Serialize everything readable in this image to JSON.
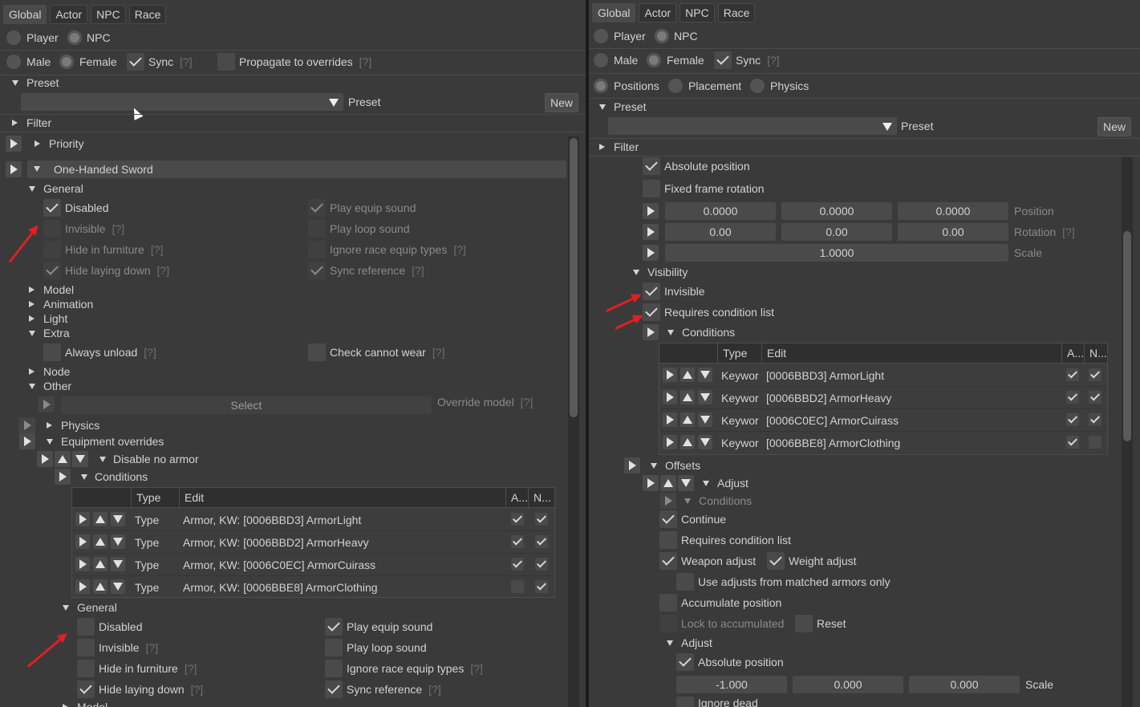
{
  "tabs": [
    "Global",
    "Actor",
    "NPC",
    "Race"
  ],
  "hint": "[?]",
  "left": {
    "player": "Player",
    "npc": "NPC",
    "male": "Male",
    "female": "Female",
    "sync": "Sync",
    "propagate": "Propagate to overrides",
    "preset_section": "Preset",
    "preset_label": "Preset",
    "new_button": "New",
    "filter": "Filter",
    "priority": "Priority",
    "sword": "One-Handed Sword",
    "general": "General",
    "disabled": "Disabled",
    "invisible": "Invisible",
    "hide_furniture": "Hide in furniture",
    "hide_laying": "Hide laying down",
    "play_equip": "Play equip sound",
    "play_loop": "Play loop sound",
    "ignore_race": "Ignore race equip types",
    "sync_ref": "Sync reference",
    "model": "Model",
    "animation": "Animation",
    "light": "Light",
    "extra": "Extra",
    "always_unload": "Always unload",
    "check_cannot_wear": "Check cannot wear",
    "node": "Node",
    "other": "Other",
    "select": "Select",
    "override_model": "Override model",
    "physics": "Physics",
    "equipment_overrides": "Equipment overrides",
    "disable_no_armor": "Disable no armor",
    "conditions": "Conditions",
    "table": {
      "headers": [
        "Type",
        "Edit",
        "A...",
        "N..."
      ],
      "rows": [
        {
          "type": "Type",
          "edit": "Armor, KW: [0006BBD3] ArmorLight"
        },
        {
          "type": "Type",
          "edit": "Armor, KW: [0006BBD2] ArmorHeavy"
        },
        {
          "type": "Type",
          "edit": "Armor, KW: [0006C0EC] ArmorCuirass"
        },
        {
          "type": "Type",
          "edit": "Armor, KW: [0006BBE8] ArmorClothing"
        }
      ]
    },
    "general2": "General",
    "model2": "Model"
  },
  "right": {
    "player": "Player",
    "npc": "NPC",
    "male": "Male",
    "female": "Female",
    "sync": "Sync",
    "positions": "Positions",
    "placement": "Placement",
    "physics": "Physics",
    "preset_section": "Preset",
    "preset_label": "Preset",
    "new_button": "New",
    "filter": "Filter",
    "absolute_position": "Absolute position",
    "fixed_frame_rotation": "Fixed frame rotation",
    "position_values": [
      "0.0000",
      "0.0000",
      "0.0000"
    ],
    "position_label": "Position",
    "rotation_values": [
      "0.00",
      "0.00",
      "0.00"
    ],
    "rotation_label": "Rotation",
    "scale_value": "1.0000",
    "scale_label": "Scale",
    "visibility": "Visibility",
    "invisible": "Invisible",
    "requires_condition_list": "Requires condition list",
    "conditions": "Conditions",
    "table": {
      "headers": [
        "Type",
        "Edit",
        "A...",
        "N..."
      ],
      "rows": [
        {
          "type": "Keywor",
          "edit": "[0006BBD3] ArmorLight"
        },
        {
          "type": "Keywor",
          "edit": "[0006BBD2] ArmorHeavy"
        },
        {
          "type": "Keywor",
          "edit": "[0006C0EC] ArmorCuirass"
        },
        {
          "type": "Keywor",
          "edit": "[0006BBE8] ArmorClothing"
        }
      ]
    },
    "offsets": "Offsets",
    "adjust": "Adjust",
    "conditions2": "Conditions",
    "continue": "Continue",
    "requires_condition_list2": "Requires condition list",
    "weapon_adjust": "Weapon adjust",
    "weight_adjust": "Weight adjust",
    "use_adjusts": "Use adjusts from matched armors only",
    "accumulate_position": "Accumulate position",
    "lock_to_accumulated": "Lock to accumulated",
    "reset": "Reset",
    "adjust2": "Adjust",
    "absolute_position2": "Absolute position",
    "scale_values2": [
      "-1.000",
      "0.000",
      "0.000"
    ],
    "scale_label2": "Scale",
    "ignore_dead": "Ignore dead"
  }
}
